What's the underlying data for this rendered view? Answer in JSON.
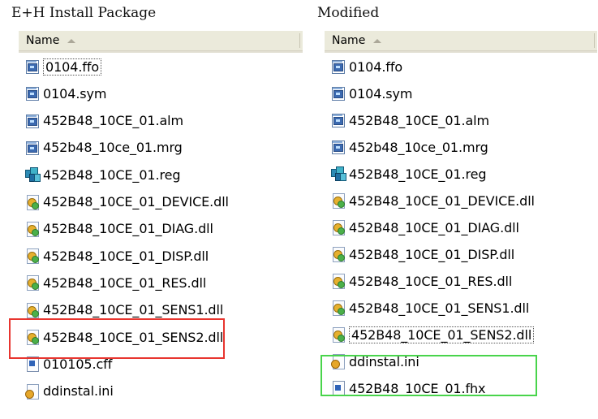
{
  "left_panel": {
    "caption": "E+H Install Package",
    "header": {
      "name_label": "Name"
    },
    "files": [
      {
        "name": "0104.ffo",
        "icon": "document-icon",
        "focused": true
      },
      {
        "name": "0104.sym",
        "icon": "document-icon"
      },
      {
        "name": "452B48_10CE_01.alm",
        "icon": "document-icon"
      },
      {
        "name": "452b48_10ce_01.mrg",
        "icon": "document-icon"
      },
      {
        "name": "452B48_10CE_01.reg",
        "icon": "registry-icon"
      },
      {
        "name": "452B48_10CE_01_DEVICE.dll",
        "icon": "dll-icon"
      },
      {
        "name": "452B48_10CE_01_DIAG.dll",
        "icon": "dll-icon"
      },
      {
        "name": "452B48_10CE_01_DISP.dll",
        "icon": "dll-icon"
      },
      {
        "name": "452B48_10CE_01_RES.dll",
        "icon": "dll-icon"
      },
      {
        "name": "452B48_10CE_01_SENS1.dll",
        "icon": "dll-icon"
      },
      {
        "name": "452B48_10CE_01_SENS2.dll",
        "icon": "dll-icon"
      },
      {
        "name": "010105.cff",
        "icon": "file-icon",
        "highlight": "#e8352f"
      },
      {
        "name": "ddinstal.ini",
        "icon": "ini-icon"
      }
    ]
  },
  "right_panel": {
    "caption": "Modified",
    "header": {
      "name_label": "Name"
    },
    "files": [
      {
        "name": "0104.ffo",
        "icon": "document-icon"
      },
      {
        "name": "0104.sym",
        "icon": "document-icon"
      },
      {
        "name": "452B48_10CE_01.alm",
        "icon": "document-icon"
      },
      {
        "name": "452b48_10ce_01.mrg",
        "icon": "document-icon"
      },
      {
        "name": "452B48_10CE_01.reg",
        "icon": "registry-icon"
      },
      {
        "name": "452B48_10CE_01_DEVICE.dll",
        "icon": "dll-icon"
      },
      {
        "name": "452B48_10CE_01_DIAG.dll",
        "icon": "dll-icon"
      },
      {
        "name": "452B48_10CE_01_DISP.dll",
        "icon": "dll-icon"
      },
      {
        "name": "452B48_10CE_01_RES.dll",
        "icon": "dll-icon"
      },
      {
        "name": "452B48_10CE_01_SENS1.dll",
        "icon": "dll-icon"
      },
      {
        "name": "452B48_10CE_01_SENS2.dll",
        "icon": "dll-icon",
        "focused": true
      },
      {
        "name": "ddinstal.ini",
        "icon": "ini-icon"
      },
      {
        "name": "452B48_10CE_01.fhx",
        "icon": "file-icon",
        "highlight": "#48d44b"
      }
    ]
  },
  "colors": {
    "header_bg": "#ebeadb",
    "highlight_red": "#e8352f",
    "highlight_green": "#48d44b"
  }
}
